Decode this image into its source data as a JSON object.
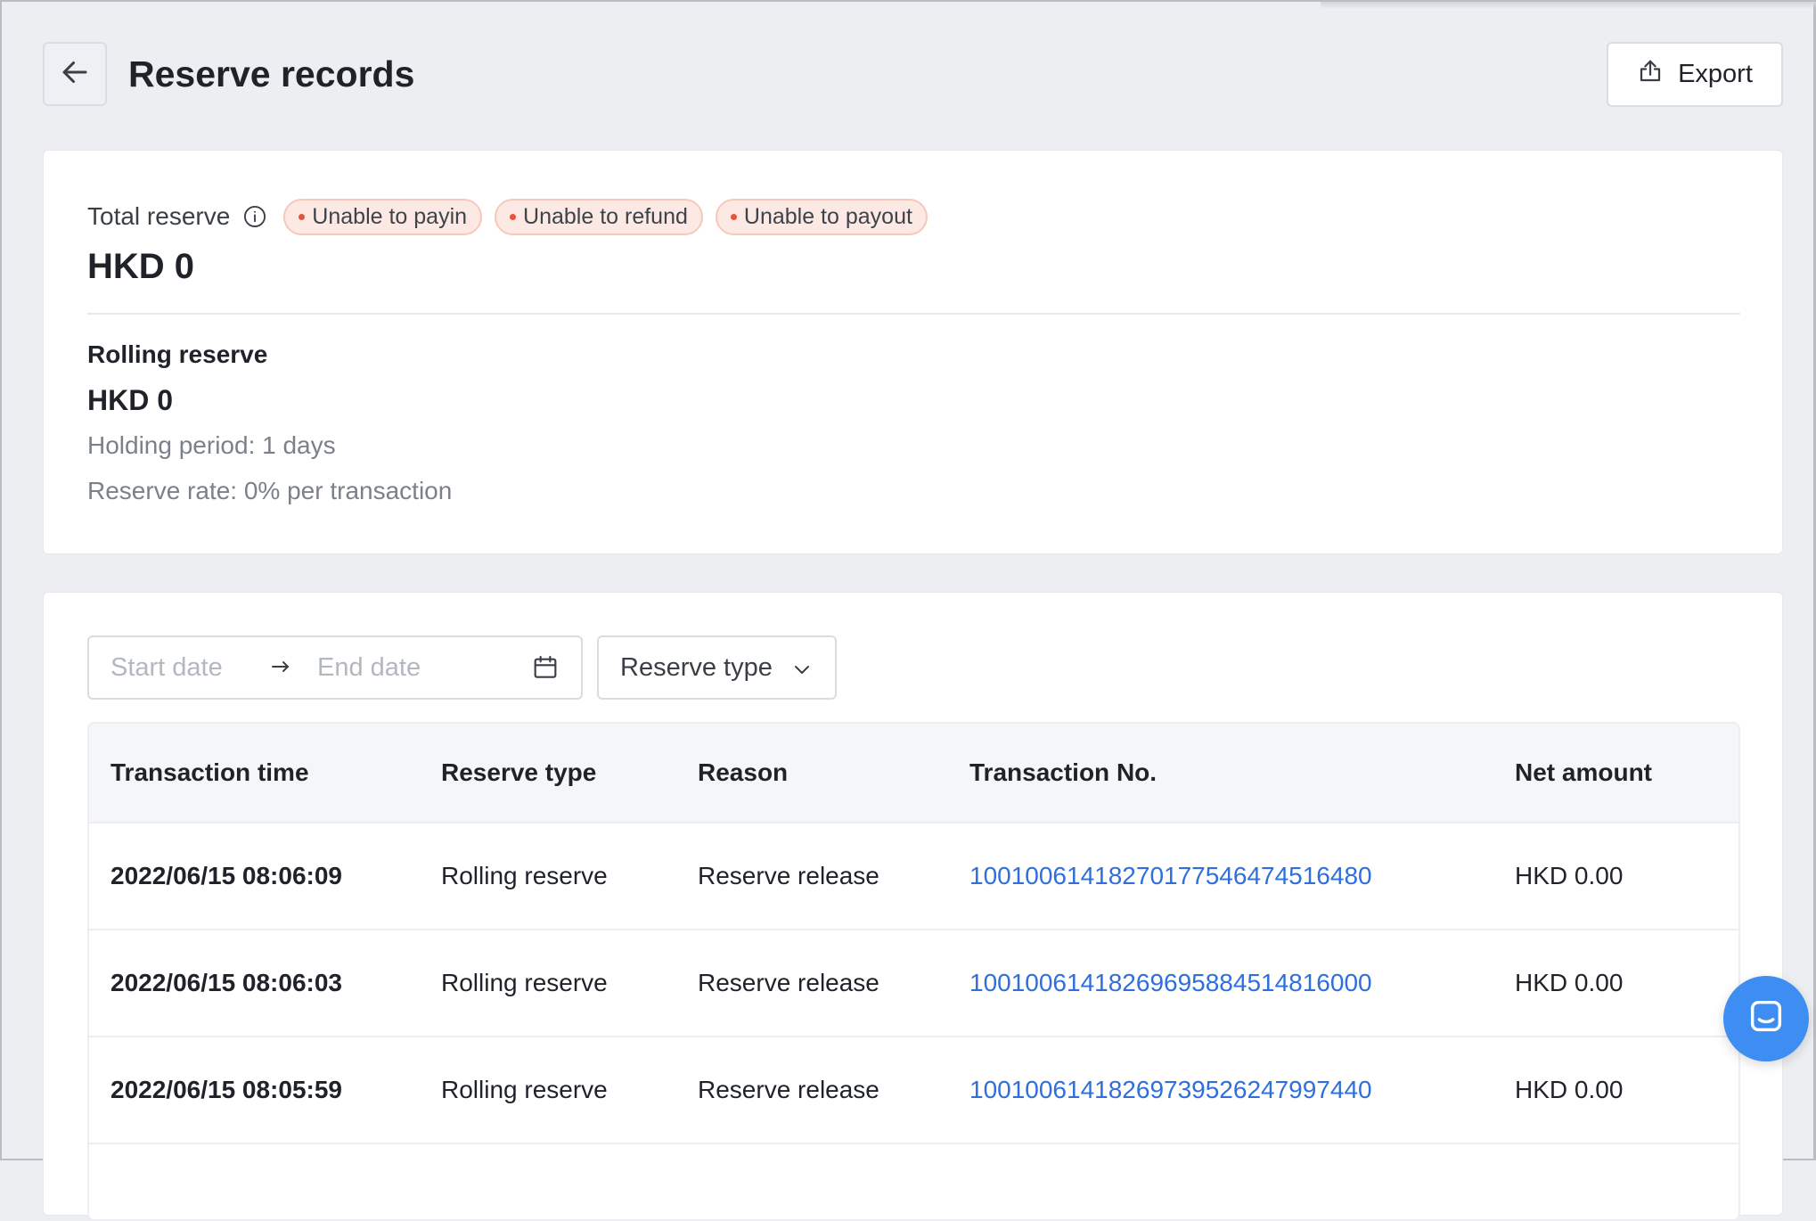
{
  "header": {
    "title": "Reserve records",
    "export_label": "Export"
  },
  "summary": {
    "total_label": "Total reserve",
    "badges": [
      "Unable to payin",
      "Unable to refund",
      "Unable to payout"
    ],
    "total_amount": "HKD 0",
    "rolling_label": "Rolling reserve",
    "rolling_amount": "HKD 0",
    "holding_period": "Holding period: 1 days",
    "reserve_rate": "Reserve rate: 0% per transaction"
  },
  "filters": {
    "start_placeholder": "Start date",
    "end_placeholder": "End date",
    "reserve_type_label": "Reserve type"
  },
  "table": {
    "columns": [
      "Transaction time",
      "Reserve type",
      "Reason",
      "Transaction No.",
      "Net amount"
    ],
    "rows": [
      [
        "2022/06/15 08:06:09",
        "Rolling reserve",
        "Reserve release",
        "1001006141827017754647451648​0",
        "HKD 0.00"
      ],
      [
        "2022/06/15 08:06:03",
        "Rolling reserve",
        "Reserve release",
        "1001006141826969588451481600​0",
        "HKD 0.00"
      ],
      [
        "2022/06/15 08:05:59",
        "Rolling reserve",
        "Reserve release",
        "1001006141826973952624799744​0",
        "HKD 0.00"
      ]
    ]
  },
  "colors": {
    "background": "#eceef2",
    "link": "#2f6fdc",
    "badge_bg": "#fde9e4",
    "badge_dot": "#e5533a",
    "chat_button": "#3e8df3"
  }
}
